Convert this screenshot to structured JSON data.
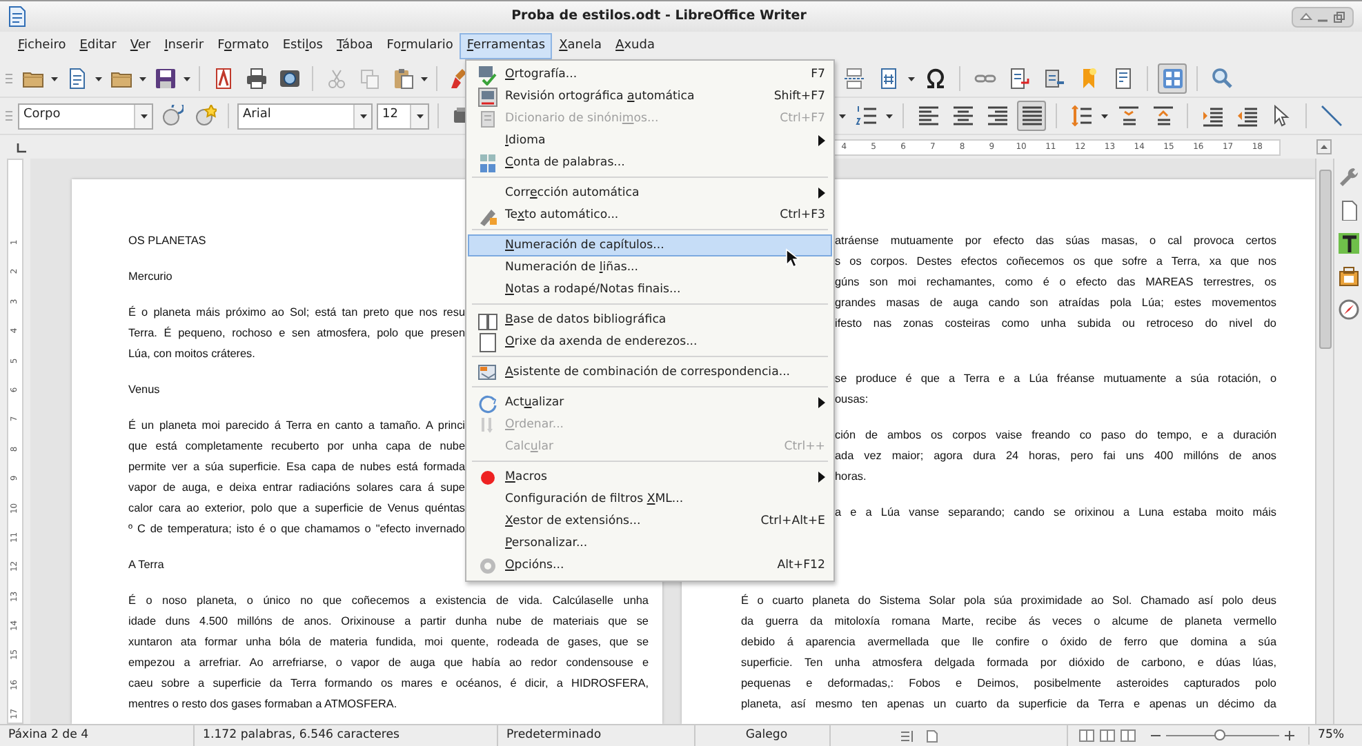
{
  "window": {
    "title": "Proba de estilos.odt - LibreOffice Writer"
  },
  "menu_bar": [
    {
      "access_key": "F",
      "text_after": "icheiro",
      "selected": false
    },
    {
      "access_key": "E",
      "text_after": "ditar",
      "selected": false
    },
    {
      "access_key": "V",
      "text_after": "er",
      "selected": false
    },
    {
      "access_key": "I",
      "text_after": "nserir",
      "selected": false
    },
    {
      "text_before": "F",
      "access_key": "o",
      "text_after": "rmato",
      "selected": false
    },
    {
      "text_before": "Esti",
      "access_key": "l",
      "text_after": "os",
      "selected": false
    },
    {
      "access_key": "T",
      "text_after": "áboa",
      "selected": false
    },
    {
      "text_before": "Fo",
      "access_key": "r",
      "text_after": "mulario",
      "selected": false
    },
    {
      "access_key": "F",
      "text_after": "erramentas",
      "selected": true
    },
    {
      "access_key": "X",
      "text_after": "anela",
      "selected": false
    },
    {
      "access_key": "A",
      "text_after": "xuda",
      "selected": false
    }
  ],
  "standard_toolbar": {
    "navigator_on": true
  },
  "formatting_toolbar": {
    "paragraph_style": "Corpo",
    "font_name": "Arial",
    "font_size": "12",
    "alignment": [
      {
        "selected": false
      },
      {
        "selected": false
      },
      {
        "selected": false
      },
      {
        "selected": true
      }
    ]
  },
  "ruler": {
    "labels": [
      "4",
      "5",
      "6",
      "7",
      "8",
      "9",
      "10",
      "11",
      "12",
      "13",
      "14",
      "15",
      "16",
      "17",
      "18"
    ]
  },
  "vertical_ruler": {
    "labels": [
      "1",
      "2",
      "3",
      "4",
      "5",
      "6",
      "7",
      "8",
      "9",
      "10",
      "11",
      "12",
      "13",
      "14",
      "15",
      "16",
      "17"
    ]
  },
  "tools_menu": {
    "items": [
      {
        "kind": "item",
        "access_key": "O",
        "text_after": "rtografía...",
        "shortcut": "F7",
        "disabled": false,
        "selected": false,
        "submenu": false
      },
      {
        "kind": "item",
        "text_before": "Revisión ortográfica ",
        "access_key": "a",
        "text_after": "utomática",
        "shortcut": "Shift+F7",
        "disabled": false,
        "selected": false,
        "submenu": false
      },
      {
        "kind": "item",
        "text_before": "Dicionario de sinóni",
        "access_key": "m",
        "text_after": "os...",
        "shortcut": "Ctrl+F7",
        "disabled": true,
        "selected": false,
        "submenu": false
      },
      {
        "kind": "item",
        "access_key": "I",
        "text_after": "dioma",
        "disabled": false,
        "selected": false,
        "submenu": true
      },
      {
        "kind": "item",
        "access_key": "C",
        "text_after": "onta de palabras...",
        "disabled": false,
        "selected": false,
        "submenu": false
      },
      {
        "kind": "separator"
      },
      {
        "kind": "item",
        "text_before": "Corr",
        "access_key": "e",
        "text_after": "cción automática",
        "disabled": false,
        "selected": false,
        "submenu": true
      },
      {
        "kind": "item",
        "text_before": "Te",
        "access_key": "x",
        "text_after": "to automático...",
        "shortcut": "Ctrl+F3",
        "disabled": false,
        "selected": false,
        "submenu": false
      },
      {
        "kind": "separator"
      },
      {
        "kind": "item",
        "access_key": "N",
        "text_after": "umeración de capítulos...",
        "disabled": false,
        "selected": true,
        "submenu": false
      },
      {
        "kind": "item",
        "text_before": "Numeración de ",
        "access_key": "l",
        "text_after": "iñas...",
        "disabled": false,
        "selected": false,
        "submenu": false
      },
      {
        "kind": "item",
        "access_key": "N",
        "text_after": "otas a rodapé/Notas finais...",
        "disabled": false,
        "selected": false,
        "submenu": false
      },
      {
        "kind": "separator"
      },
      {
        "kind": "item",
        "access_key": "B",
        "text_after": "ase de datos bibliográfica",
        "disabled": false,
        "selected": false,
        "submenu": false
      },
      {
        "kind": "item",
        "access_key": "O",
        "text_after": "rixe da axenda de enderezos...",
        "disabled": false,
        "selected": false,
        "submenu": false
      },
      {
        "kind": "separator"
      },
      {
        "kind": "item",
        "access_key": "A",
        "text_after": "sistente de combinación de correspondencia...",
        "disabled": false,
        "selected": false,
        "submenu": false
      },
      {
        "kind": "separator"
      },
      {
        "kind": "item",
        "text_before": "Act",
        "access_key": "u",
        "text_after": "alizar",
        "disabled": false,
        "selected": false,
        "submenu": true
      },
      {
        "kind": "item",
        "access_key": "O",
        "text_after": "rdenar...",
        "disabled": true,
        "selected": false,
        "submenu": false
      },
      {
        "kind": "item",
        "text_before": "Calc",
        "access_key": "u",
        "text_after": "lar",
        "shortcut": "Ctrl++",
        "disabled": true,
        "selected": false,
        "submenu": false
      },
      {
        "kind": "separator"
      },
      {
        "kind": "item",
        "access_key": "M",
        "text_after": "acros",
        "disabled": false,
        "selected": false,
        "submenu": true
      },
      {
        "kind": "item",
        "text_before": "Configuración de filtros ",
        "access_key": "X",
        "text_after": "ML...",
        "disabled": false,
        "selected": false,
        "submenu": false
      },
      {
        "kind": "item",
        "access_key": "X",
        "text_after": "estor de extensións...",
        "shortcut": "Ctrl+Alt+E",
        "disabled": false,
        "selected": false,
        "submenu": false
      },
      {
        "kind": "item",
        "access_key": "P",
        "text_after": "ersonalizar...",
        "disabled": false,
        "selected": false,
        "submenu": false
      },
      {
        "kind": "item",
        "access_key": "O",
        "text_after": "pcións...",
        "shortcut": "Alt+F12",
        "disabled": false,
        "selected": false,
        "submenu": false
      }
    ]
  },
  "document": {
    "pages": [
      {
        "blocks": [
          {
            "lines": [
              {
                "kind": "last",
                "text": "OS PLANETAS"
              }
            ]
          },
          {
            "lines": [
              {
                "kind": "last",
                "text": "Mercurio"
              }
            ]
          },
          {
            "lines": [
              {
                "kind": "cut_right",
                "text": "É o planeta máis próximo ao Sol; está tan preto que nos resu"
              },
              {
                "kind": "cut_right",
                "text": "Terra. É pequeno, rochoso e sen atmosfera, polo que presen"
              },
              {
                "kind": "last",
                "text": "Lúa, con moitos cráteres."
              }
            ]
          },
          {
            "lines": [
              {
                "kind": "last",
                "text": "Venus"
              }
            ]
          },
          {
            "lines": [
              {
                "kind": "cut_right",
                "text": "É un planeta moi parecido á Terra en canto a tamaño. A princi"
              },
              {
                "kind": "cut_right",
                "text": "que está completamente recuberto por unha capa de nube"
              },
              {
                "kind": "cut_right",
                "text": "permite ver a súa superficie. Esa capa de nubes está formada"
              },
              {
                "kind": "cut_right",
                "text": "vapor de auga, e deixa entrar radiacións solares cara á supe"
              },
              {
                "kind": "cut_right",
                "text": "calor cara ao exterior, polo que a superficie de  Venus quéntas"
              },
              {
                "kind": "cut_right",
                "text": "º C de temperatura; isto é o que chamamos o \"efecto invernado"
              }
            ]
          },
          {
            "lines": [
              {
                "kind": "last",
                "text": "A Terra"
              }
            ]
          },
          {
            "lines": [
              {
                "kind": "justified",
                "text": "É o noso planeta, o único no que coñecemos a existencia de vida. Calcúlaselle unha"
              },
              {
                "kind": "justified",
                "text": "idade duns 4.500 millóns de anos. Orixinouse a partir dunha nube de materiais que se"
              },
              {
                "kind": "justified",
                "text": "xuntaron ata formar unha bóla de materia fundida, moi quente, rodeada de gases, que se"
              },
              {
                "kind": "justified",
                "text": "empezou a arrefriar. Ao arrefriarse, o vapor de auga que había ao redor condensouse e"
              },
              {
                "kind": "justified",
                "text": "caeu sobre a superficie da Terra formando os mares e océanos, é dicir, a  HIDROSFERA,"
              },
              {
                "kind": "last",
                "text": "mentres o resto dos gases formaban a ATMOSFERA."
              }
            ]
          }
        ]
      },
      {
        "blocks": [
          {
            "lines": [
              {
                "kind": "cut_left",
                "text": "atráense mutuamente por efecto das súas masas, o cal provoca certos"
              },
              {
                "kind": "cut_left",
                "text": "s os corpos. Destes efectos coñecemos os que sofre a Terra, xa que nos"
              },
              {
                "kind": "cut_left",
                "text": "gúns son moi rechamantes, como é o efecto das MAREAS terrestres, os"
              },
              {
                "kind": "cut_left",
                "text": "grandes masas de auga cando son atraídas pola Lúa; estes movementos"
              },
              {
                "kind": "cut_left",
                "text": "ifesto nas zonas costeiras como unha subida ou retroceso do nivel do"
              }
            ]
          },
          {
            "lines": [
              {
                "kind": "cut_left",
                "text": "se produce é que a Terra e a Lúa fréanse mutuamente a súa rotación, o"
              },
              {
                "kind": "cut_left_last",
                "text": "ousas:"
              }
            ]
          },
          {
            "lines": [
              {
                "kind": "cut_left",
                "text": "ción de ambos os corpos vaise freando co paso do tempo, e a duración"
              },
              {
                "kind": "cut_left",
                "text": "ada vez maior; agora dura 24 horas, pero fai uns 400 millóns de anos"
              },
              {
                "kind": "cut_left_last",
                "text": "horas."
              }
            ]
          },
          {
            "lines": [
              {
                "kind": "cut_left",
                "text": "a e a Lúa vanse separando; cando se orixinou a Luna estaba moito máis"
              }
            ]
          },
          {
            "lines": [
              {
                "kind": "justified",
                "text": "É o cuarto planeta do Sistema Solar pola súa proximidade ao Sol. Chamado así polo deus"
              },
              {
                "kind": "justified",
                "text": "da guerra da mitoloxía romana Marte, recibe ás veces o alcume de planeta vermello"
              },
              {
                "kind": "justified",
                "text": "debido á aparencia avermellada que lle confire o óxido de ferro que domina a súa"
              },
              {
                "kind": "justified",
                "text": "superficie. Ten unha atmosfera delgada formada por dióxido de carbono, e dúas lúas,"
              },
              {
                "kind": "justified",
                "text": "pequenas e deformadas,: Fobos e Deimos, posibelmente asteroides capturados polo"
              },
              {
                "kind": "justified",
                "text": "planeta, así mesmo ten apenas un cuarto da superficie da Terra e apenas un décimo da"
              }
            ]
          }
        ]
      }
    ]
  },
  "status_bar": {
    "page": "Páxina 2 de 4",
    "word_count": "1.172 palabras, 6.546 caracteres",
    "page_style": "Predeterminado",
    "language": "Galego",
    "zoom": {
      "level": 0.48,
      "reading": "75%"
    }
  }
}
